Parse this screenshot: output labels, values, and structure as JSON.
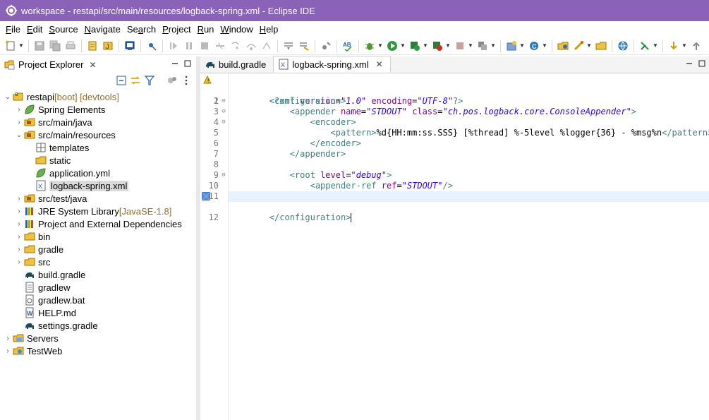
{
  "window": {
    "title": "workspace - restapi/src/main/resources/logback-spring.xml - Eclipse IDE"
  },
  "menu": [
    {
      "u": "F",
      "rest": "ile"
    },
    {
      "u": "E",
      "rest": "dit"
    },
    {
      "u": "S",
      "rest": "ource"
    },
    {
      "u": "N",
      "rest": "avigate"
    },
    {
      "pre": "Se",
      "u": "a",
      "rest": "rch"
    },
    {
      "u": "P",
      "rest": "roject"
    },
    {
      "u": "R",
      "rest": "un"
    },
    {
      "u": "W",
      "rest": "indow"
    },
    {
      "u": "H",
      "rest": "elp"
    }
  ],
  "project_explorer": {
    "title": "Project Explorer",
    "items": [
      {
        "label": "restapi",
        "extra": " [boot] [devtools]"
      },
      {
        "label": "Spring Elements"
      },
      {
        "label": "src/main/java"
      },
      {
        "label": "src/main/resources"
      },
      {
        "label": "templates"
      },
      {
        "label": "static"
      },
      {
        "label": "application.yml"
      },
      {
        "label": "logback-spring.xml"
      },
      {
        "label": "src/test/java"
      },
      {
        "label": "JRE System Library",
        "extra": " [JavaSE-1.8]"
      },
      {
        "label": "Project and External Dependencies"
      },
      {
        "label": "bin"
      },
      {
        "label": "gradle"
      },
      {
        "label": "src"
      },
      {
        "label": "build.gradle"
      },
      {
        "label": "gradlew"
      },
      {
        "label": "gradlew.bat"
      },
      {
        "label": "HELP.md"
      },
      {
        "label": "settings.gradle"
      },
      {
        "label": "Servers"
      },
      {
        "label": "TestWeb"
      }
    ]
  },
  "editor": {
    "tabs": [
      {
        "label": "build.gradle"
      },
      {
        "label": "logback-spring.xml"
      }
    ],
    "line_numbers": [
      "1",
      "2",
      "3",
      "4",
      "5",
      "6",
      "7",
      "8",
      "9",
      "10",
      "11",
      "12"
    ]
  },
  "colors": {
    "titlebar": "#8a63b8",
    "tag": "#3f7f7f",
    "attr": "#7f007f",
    "value": "#2a00ff"
  }
}
